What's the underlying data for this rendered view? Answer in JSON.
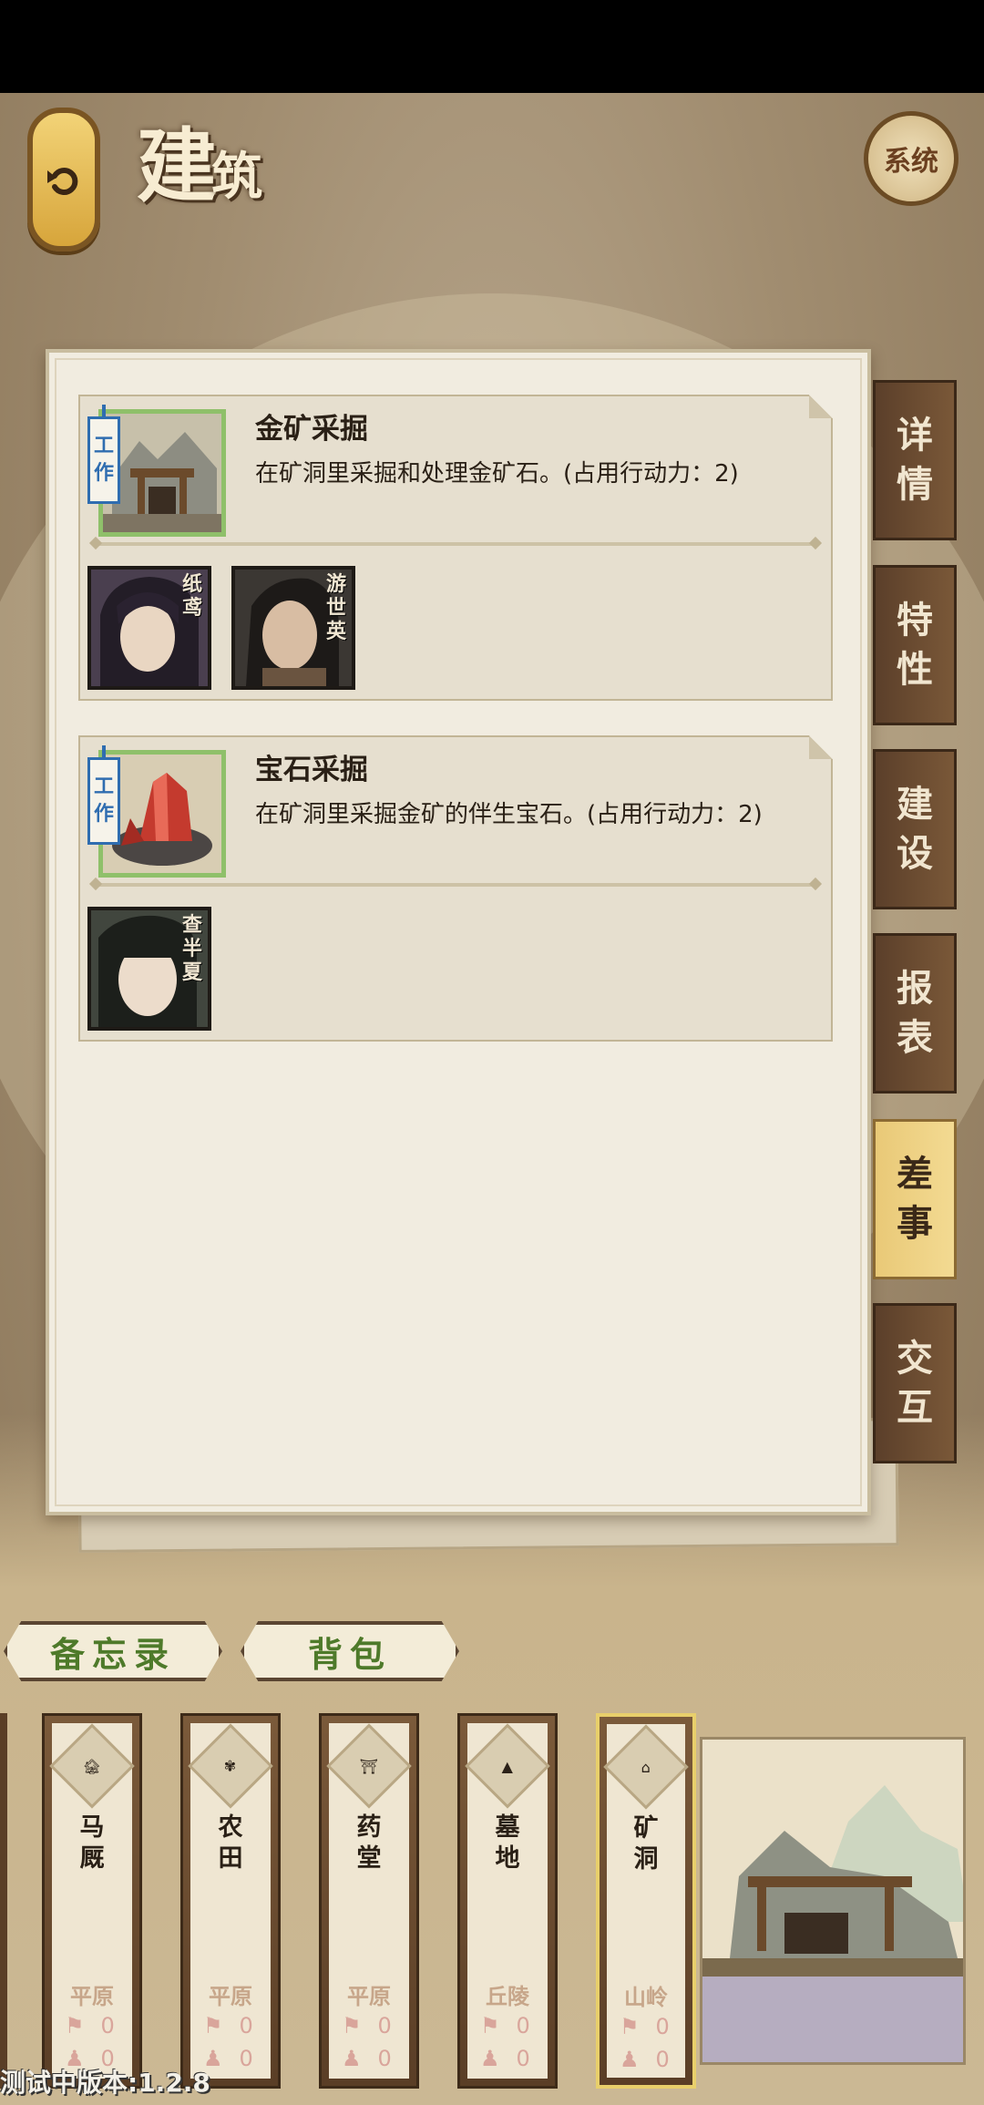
{
  "header": {
    "title_big": "建",
    "title_small": "筑",
    "system_label": "系统"
  },
  "tasks": [
    {
      "tag": "工作",
      "name": "金矿采掘",
      "desc": "在矿洞里采掘和处理金矿石。(占用行动力：2)",
      "workers": [
        "纸鸢",
        "游世英"
      ]
    },
    {
      "tag": "工作",
      "name": "宝石采掘",
      "desc": "在矿洞里采掘金矿的伴生宝石。(占用行动力：2)",
      "workers": [
        "查半夏"
      ]
    }
  ],
  "side_tabs": [
    "详情",
    "特性",
    "建设",
    "报表",
    "差事",
    "交互"
  ],
  "active_tab": "差事",
  "bottom_buttons": {
    "memo": "备忘录",
    "bag": "背包"
  },
  "buildings": [
    {
      "name": "马厩",
      "terrain": "平原",
      "stat1": "0",
      "stat2": "0"
    },
    {
      "name": "农田",
      "terrain": "平原",
      "stat1": "0",
      "stat2": "0"
    },
    {
      "name": "药堂",
      "terrain": "平原",
      "stat1": "0",
      "stat2": "0"
    },
    {
      "name": "墓地",
      "terrain": "丘陵",
      "stat1": "0",
      "stat2": "0"
    },
    {
      "name": "矿洞",
      "terrain": "山岭",
      "stat1": "0",
      "stat2": "0"
    }
  ],
  "selected_building": "矿洞",
  "version": "测试中版本:1.2.8"
}
